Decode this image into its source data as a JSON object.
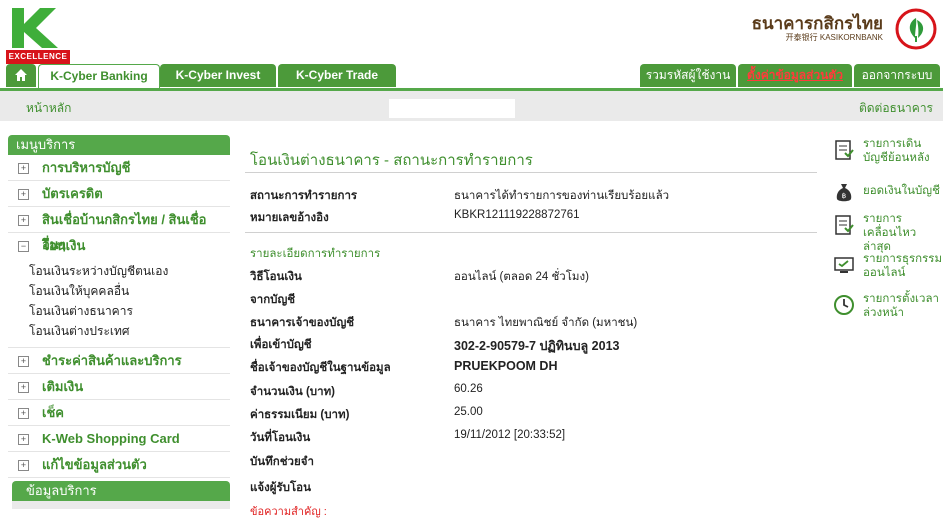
{
  "brand": {
    "k_excellence": "EXCELLENCE",
    "bank_thai": "ธนาคารกสิกรไทย",
    "bank_en": "开泰银行 KASIKORNBANK"
  },
  "top_nav": {
    "tabs": [
      "K-Cyber Banking",
      "K-Cyber Invest",
      "K-Cyber Trade"
    ],
    "right": [
      "รวมรหัสผู้ใช้งาน",
      "ตั้งค่าข้อมูลส่วนตัว",
      "ออกจากระบบ"
    ]
  },
  "sub_bar": {
    "home": "หน้าหลัก",
    "contact": "ติดต่อธนาคาร"
  },
  "sidebar": {
    "header": "เมนูบริการ",
    "items_top": [
      "การบริหารบัญชี",
      "บัตรเครดิต",
      "สินเชื่อบ้านกสิกรไทย / สินเชื่ออื่นๆ"
    ],
    "transfer": {
      "label": "โอนเงิน",
      "sub": [
        "โอนเงินระหว่างบัญชีตนเอง",
        "โอนเงินให้บุคคลอื่น",
        "โอนเงินต่างธนาคาร",
        "โอนเงินต่างประเทศ"
      ]
    },
    "items_bottom": [
      "ชำระค่าสินค้าและบริการ",
      "เติมเงิน",
      "เช็ค",
      "K-Web Shopping Card",
      "แก้ไขข้อมูลส่วนตัว"
    ],
    "footer_header": "ข้อมูลบริการ"
  },
  "main": {
    "title": "โอนเงินต่างธนาคาร - สถานะการทำรายการ",
    "status_label": "สถานะการทำรายการ",
    "status_value": "ธนาคารได้ทำรายการของท่านเรียบร้อยแล้ว",
    "ref_label": "หมายเลขอ้างอิง",
    "ref_value": "KBKR121119228872761",
    "detail_title": "รายละเอียดการทำรายการ",
    "details": [
      {
        "label": "วิธีโอนเงิน",
        "value": "ออนไลน์ (ตลอด 24 ชั่วโมง)"
      },
      {
        "label": "จากบัญชี",
        "value": ""
      },
      {
        "label": "ธนาคารเจ้าของบัญชี",
        "value": "ธนาคาร ไทยพาณิชย์ จำกัด (มหาชน)"
      },
      {
        "label": "เพื่อเข้าบัญชี",
        "value": "302-2-90579-7 ปฏิทินบลู 2013"
      },
      {
        "label": "ชื่อเจ้าของบัญชีในฐานข้อมูล",
        "value": "PRUEKPOOM DH"
      },
      {
        "label": "จำนวนเงิน (บาท)",
        "value": "60.26"
      },
      {
        "label": "ค่าธรรมเนียม (บาท)",
        "value": "25.00"
      },
      {
        "label": "วันที่โอนเงิน",
        "value": "19/11/2012 [20:33:52]"
      },
      {
        "label": "บันทึกช่วยจำ",
        "value": ""
      },
      {
        "label": "แจ้งผู้รับโอน",
        "value": ""
      }
    ],
    "red_note": "ข้อความสำคัญ :"
  },
  "right_links": [
    {
      "icon": "statement-icon",
      "text": "รายการเดินบัญชีย้อนหลัง"
    },
    {
      "icon": "money-bag-icon",
      "text": "ยอดเงินในบัญชี"
    },
    {
      "icon": "recent-transactions-icon",
      "text": "รายการเคลื่อนไหวล่าสุด"
    },
    {
      "icon": "online-transactions-icon",
      "text": "รายการธุรกรรมออนไลน์"
    },
    {
      "icon": "clock-icon",
      "text": "รายการตั้งเวลาล่วงหน้า"
    }
  ],
  "colors": {
    "brand_green": "#55a84a",
    "tab_green": "#4c9a3a",
    "text_green": "#3f8f2e",
    "alert_red": "#e02020"
  }
}
